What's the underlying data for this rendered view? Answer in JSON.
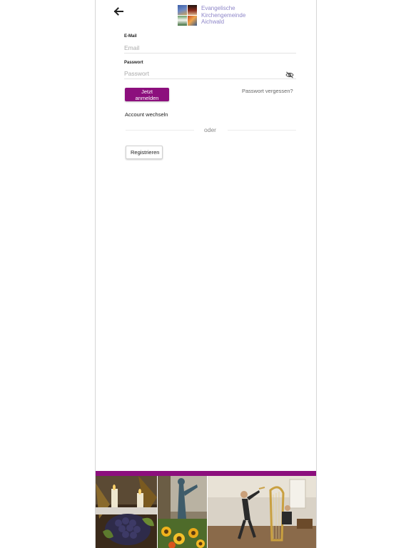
{
  "header": {
    "back_icon": "arrow-left-icon",
    "logo": {
      "line1": "Evangelische",
      "line2": "Kirchengemeinde",
      "line3": "Aichwald",
      "color": "#8f87c9"
    }
  },
  "form": {
    "email_label": "E-Mail",
    "email_placeholder": "Email",
    "email_value": "",
    "password_label": "Passwort",
    "password_placeholder": "Passwort",
    "password_value": "",
    "toggle_icon": "eye-off-icon",
    "login_button": "Jetzt anmelden",
    "forgot_password": "Passwort vergessen?",
    "switch_account": "Account wechseln",
    "divider_text": "oder",
    "register_button": "Registrieren"
  },
  "footer": {
    "accent_color": "#8c0f7d",
    "photos": [
      "candles-grapes-photo",
      "sculpture-sunflowers-photo",
      "harp-concert-photo"
    ]
  },
  "colors": {
    "primary": "#8c0f7d",
    "logo_text": "#8f87c9"
  }
}
